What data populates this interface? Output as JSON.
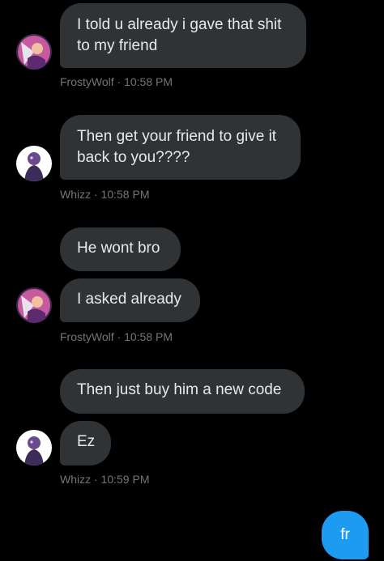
{
  "messages": [
    {
      "sender": "FrostyWolf",
      "text_line1": "I told u already i gave that shit",
      "text_line2": "to my friend"
    },
    {
      "sender": "Whizz",
      "text_line1": "Then get your friend to give it",
      "text_line2": "back to you????"
    },
    {
      "sender": "FrostyWolf",
      "text": "He wont bro"
    },
    {
      "sender": "FrostyWolf",
      "text": "I asked already"
    },
    {
      "sender": "Whizz",
      "text": "Then just buy him a new code"
    },
    {
      "sender": "Whizz",
      "text": "Ez"
    },
    {
      "sender": "me",
      "text": "fr"
    }
  ],
  "meta": {
    "m1": "FrostyWolf · 10:58 PM",
    "m2": "Whizz · 10:58 PM",
    "m3": "FrostyWolf · 10:58 PM",
    "m4": "Whizz · 10:59 PM"
  },
  "colors": {
    "background": "#000000",
    "incoming_bubble": "#2f3336",
    "outgoing_bubble": "#1d9bf0",
    "meta_text": "#71767b"
  },
  "icons": {
    "frostywolf_avatar": "frostywolf-avatar",
    "whizz_avatar": "whizz-avatar"
  }
}
